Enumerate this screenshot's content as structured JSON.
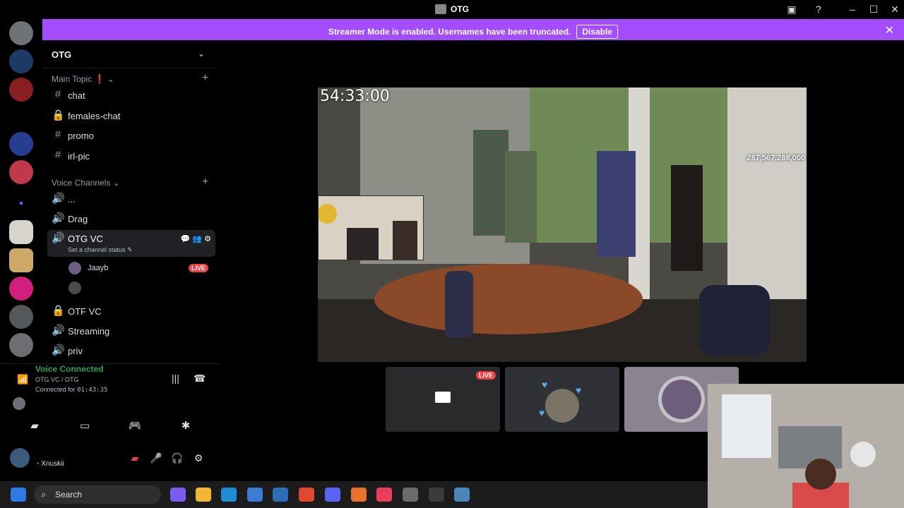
{
  "titlebar": {
    "title": "OTG",
    "inbox_icon": "inbox-icon",
    "help_icon": "help-icon"
  },
  "banner": {
    "message": "Streamer Mode is enabled. Usernames have been truncated.",
    "disable_label": "Disable"
  },
  "guild": {
    "name": "OTG"
  },
  "categories": {
    "main_topic": "Main Topic ❗",
    "voice_channels": "Voice Channels"
  },
  "text_channels": [
    {
      "label": "chat",
      "icon": "hash"
    },
    {
      "label": "females-chat",
      "icon": "lock"
    },
    {
      "label": "promo",
      "icon": "hash"
    },
    {
      "label": "irl-pic",
      "icon": "hash"
    }
  ],
  "voice_channels": [
    {
      "label": "..."
    },
    {
      "label": "Drag"
    },
    {
      "label": "OTG VC",
      "sub": "Set a channel status ✎"
    },
    {
      "label": "OTF VC"
    },
    {
      "label": "Streaming"
    },
    {
      "label": "priv"
    }
  ],
  "members": [
    {
      "name": "Jaayb",
      "badge": "LIVE"
    },
    {
      "name": ""
    }
  ],
  "voice": {
    "status": "Voice Connected",
    "channel": "OTG VC / OTG",
    "connected_prefix": "Connected for",
    "connected_time": "01:43:35"
  },
  "user": {
    "name": "Xnuskii",
    "prefix": "•"
  },
  "stream": {
    "timer": "54:33:00",
    "viewer_text": "287,567,288,000"
  },
  "tiles": [
    {
      "badge": "LIVE"
    },
    {
      "badge": ""
    },
    {
      "badge": ""
    }
  ],
  "taskbar": {
    "search_label": "Search"
  },
  "colors": {
    "banner": "#a34dff",
    "voice_green": "#23a55a",
    "live_red": "#ed4245"
  }
}
